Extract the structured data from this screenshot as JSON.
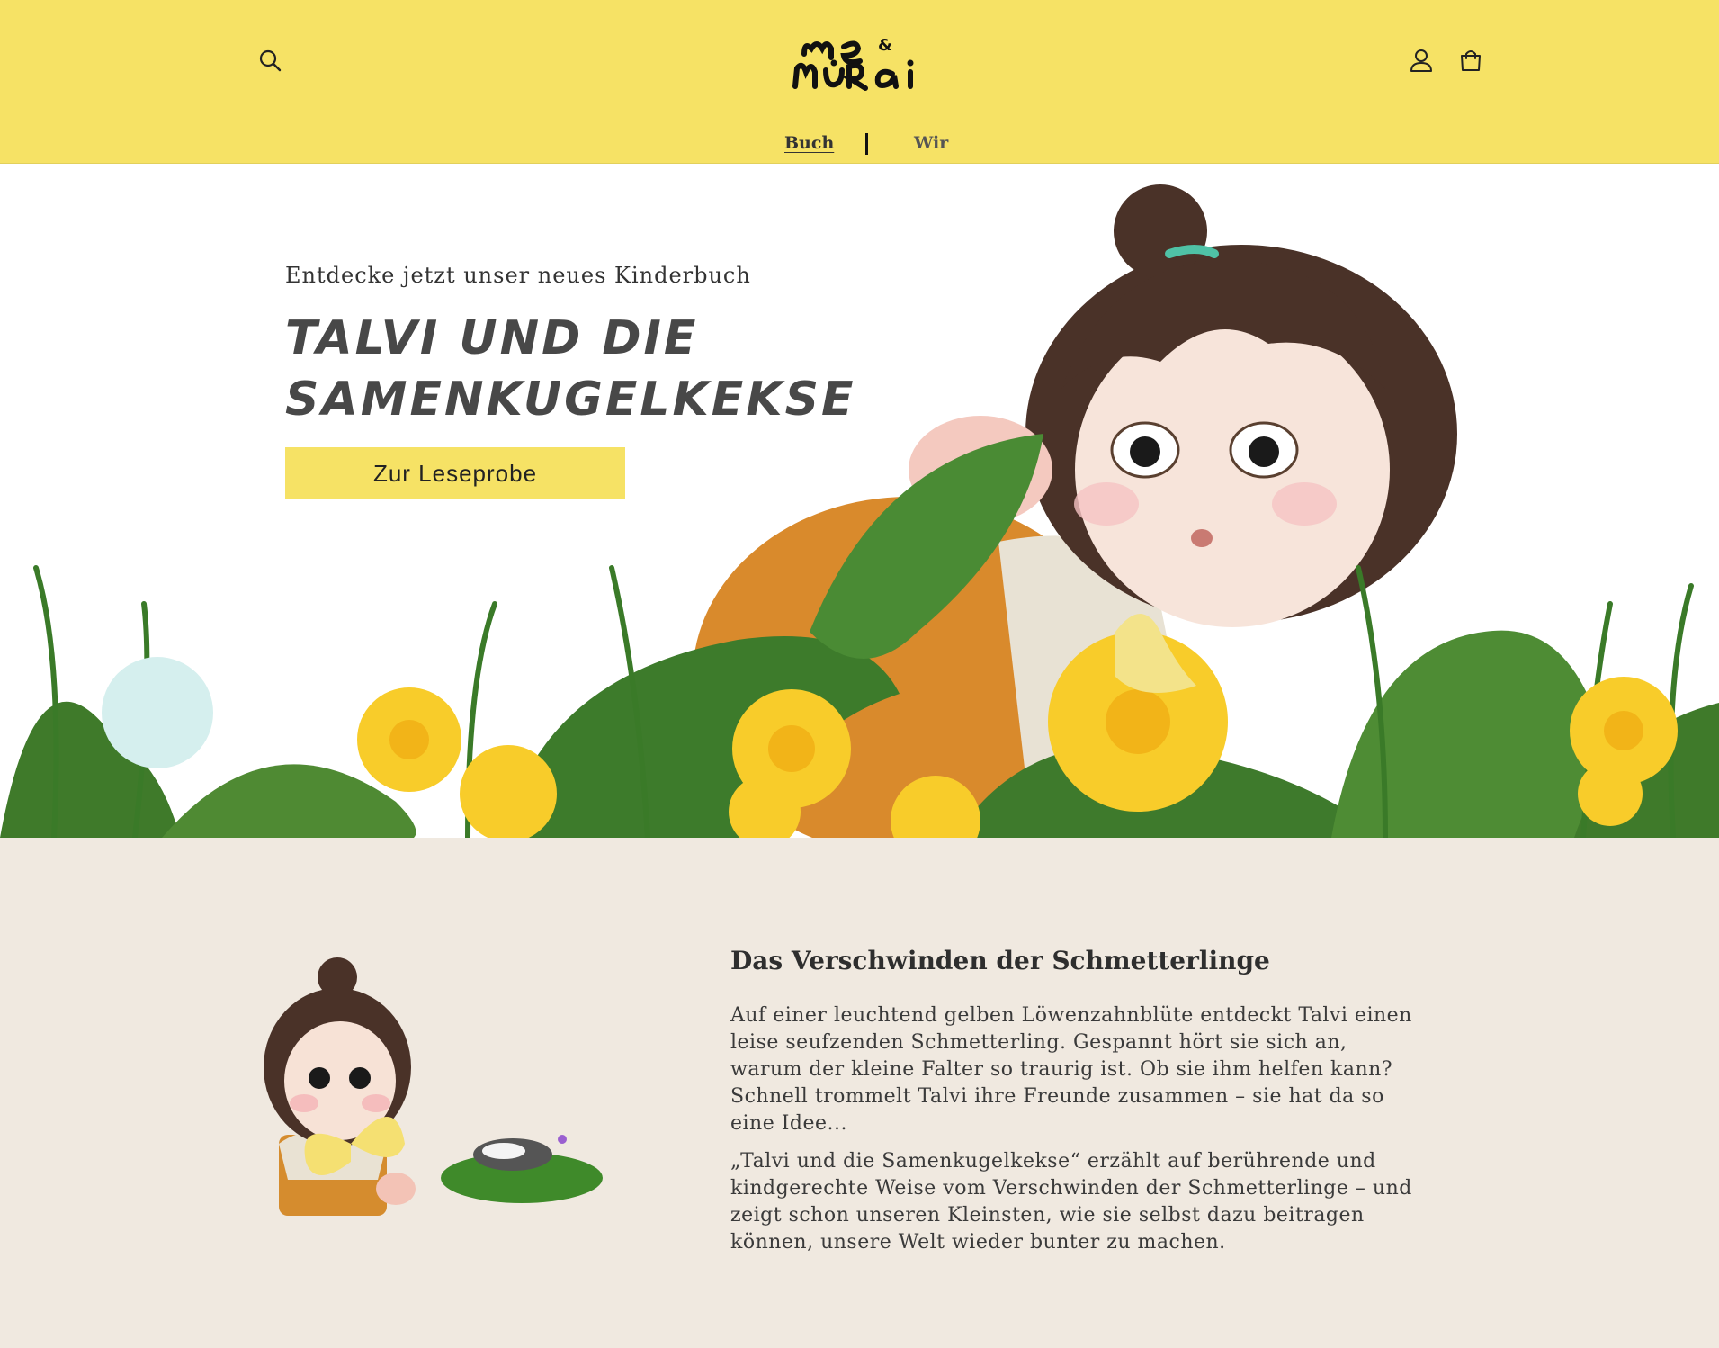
{
  "header": {
    "logo_text": "me & murai",
    "search_icon": "search-icon",
    "account_icon": "user-icon",
    "cart_icon": "shopping-bag-icon",
    "background_color": "#f6e265"
  },
  "nav": {
    "items": [
      {
        "label": "Buch",
        "active": true
      },
      {
        "label": "Wir",
        "active": false
      }
    ]
  },
  "hero": {
    "kicker": "Entdecke jetzt unser neues Kinderbuch",
    "title": "TALVI UND DIE SAMENKUGELKEKSE",
    "cta_label": "Zur Leseprobe",
    "cta_color": "#f6e265"
  },
  "story": {
    "heading": "Das Verschwinden der Schmetterlinge",
    "paragraph_1": "Auf einer leuchtend gelben Löwenzahnblüte entdeckt Talvi einen leise seufzenden Schmetterling. Gespannt hört sie sich an, warum der kleine Falter so traurig ist. Ob sie ihm helfen kann? Schnell trommelt Talvi ihre Freunde zusammen – sie hat da so eine Idee...",
    "paragraph_2": "„Talvi und die Samenkugelkekse“ erzählt auf berührende und kindgerechte Weise vom Verschwinden der Schmetterlinge – und zeigt schon unseren Kleinsten, wie sie selbst dazu beitragen können, unsere Welt wieder bunter zu machen.",
    "background_color": "#f0e9e0"
  }
}
